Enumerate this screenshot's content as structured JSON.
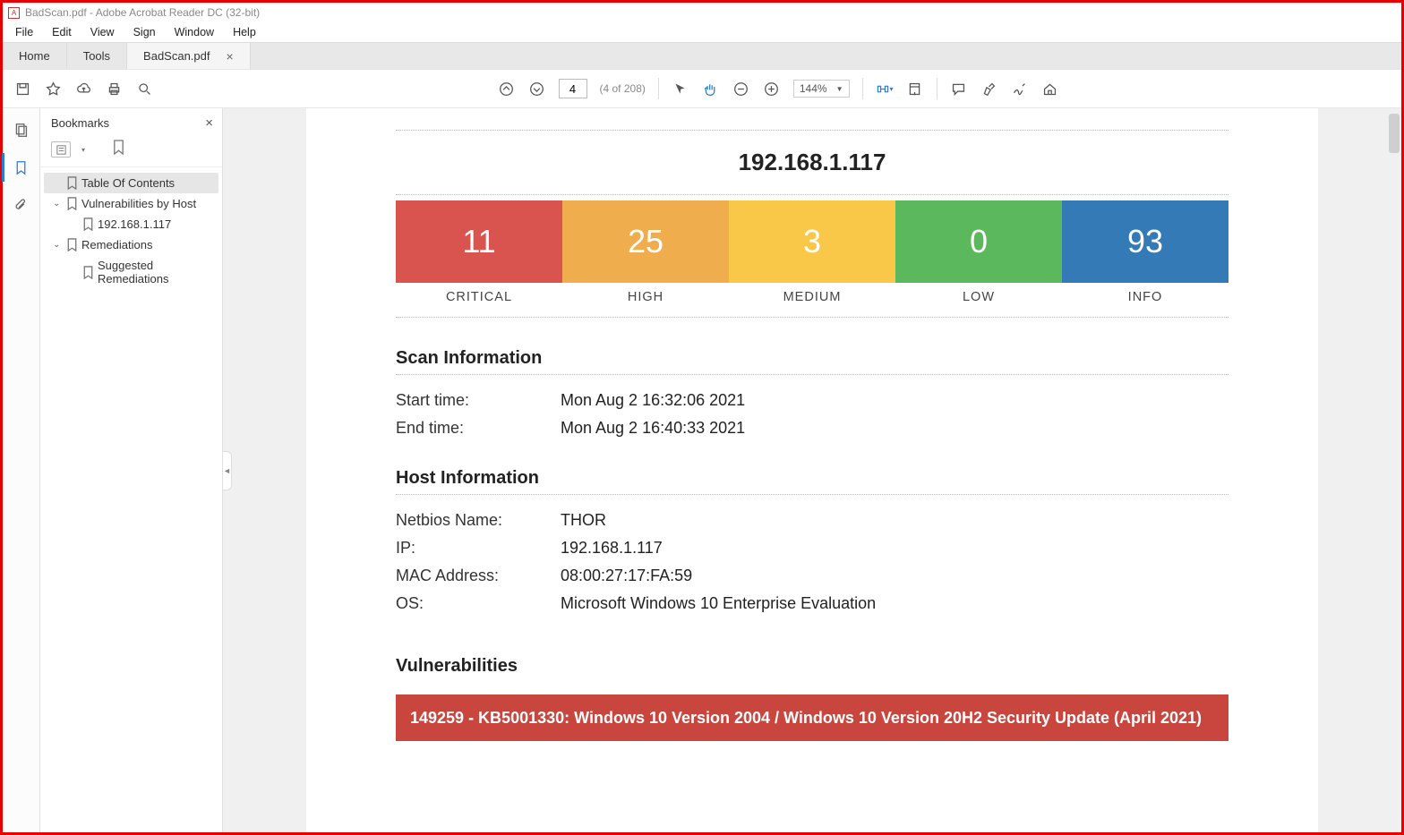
{
  "window": {
    "title": "BadScan.pdf - Adobe Acrobat Reader DC (32-bit)"
  },
  "menu": {
    "file": "File",
    "edit": "Edit",
    "view": "View",
    "sign": "Sign",
    "window": "Window",
    "help": "Help"
  },
  "tabs": {
    "home": "Home",
    "tools": "Tools",
    "doc": "BadScan.pdf"
  },
  "toolbar": {
    "page_value": "4",
    "page_count": "(4 of 208)",
    "zoom": "144%"
  },
  "sidebar": {
    "title": "Bookmarks",
    "nodes": {
      "toc": "Table Of Contents",
      "vuln_by_host": "Vulnerabilities by Host",
      "host1": "192.168.1.117",
      "remediations": "Remediations",
      "suggested": "Suggested Remediations"
    }
  },
  "doc": {
    "host_ip": "192.168.1.117",
    "severity": {
      "critical": {
        "count": "11",
        "label": "CRITICAL"
      },
      "high": {
        "count": "25",
        "label": "HIGH"
      },
      "medium": {
        "count": "3",
        "label": "MEDIUM"
      },
      "low": {
        "count": "0",
        "label": "LOW"
      },
      "info": {
        "count": "93",
        "label": "INFO"
      }
    },
    "scan_info_h": "Scan Information",
    "scan_info": {
      "start_k": "Start time:",
      "start_v": "Mon Aug 2 16:32:06 2021",
      "end_k": "End time:",
      "end_v": "Mon Aug 2 16:40:33 2021"
    },
    "host_info_h": "Host Information",
    "host_info": {
      "nb_k": "Netbios Name:",
      "nb_v": "THOR",
      "ip_k": "IP:",
      "ip_v": "192.168.1.117",
      "mac_k": "MAC Address:",
      "mac_v": "08:00:27:17:FA:59",
      "os_k": "OS:",
      "os_v": "Microsoft Windows 10 Enterprise Evaluation"
    },
    "vuln_h": "Vulnerabilities",
    "cve1": "149259 - KB5001330: Windows 10 Version 2004 / Windows 10 Version 20H2 Security Update (April 2021)"
  }
}
